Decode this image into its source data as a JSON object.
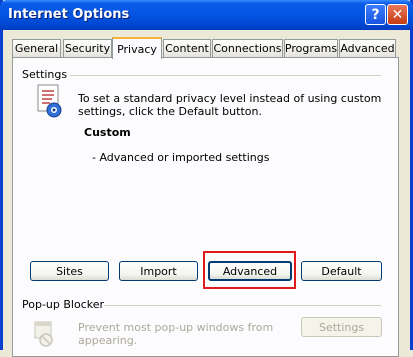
{
  "window": {
    "title": "Internet Options",
    "help_label": "?",
    "close_label": "✕"
  },
  "tabs": [
    {
      "label": "General"
    },
    {
      "label": "Security"
    },
    {
      "label": "Privacy"
    },
    {
      "label": "Content"
    },
    {
      "label": "Connections"
    },
    {
      "label": "Programs"
    },
    {
      "label": "Advanced"
    }
  ],
  "active_tab": "Privacy",
  "settings": {
    "group_label": "Settings",
    "description_line1": "To set a standard privacy level instead of using custom",
    "description_line2": "settings, click the Default button.",
    "level_name": "Custom",
    "level_detail": "- Advanced or imported settings",
    "buttons": {
      "sites": "Sites",
      "import": "Import",
      "advanced": "Advanced",
      "default": "Default"
    }
  },
  "popup_blocker": {
    "group_label": "Pop-up Blocker",
    "description_line1": "Prevent most pop-up windows from",
    "description_line2": "appearing.",
    "settings_button": "Settings"
  },
  "colors": {
    "title_bar": "#0454e2",
    "highlight_border": "#e0191b",
    "active_tab_accent": "#f6b33c"
  }
}
